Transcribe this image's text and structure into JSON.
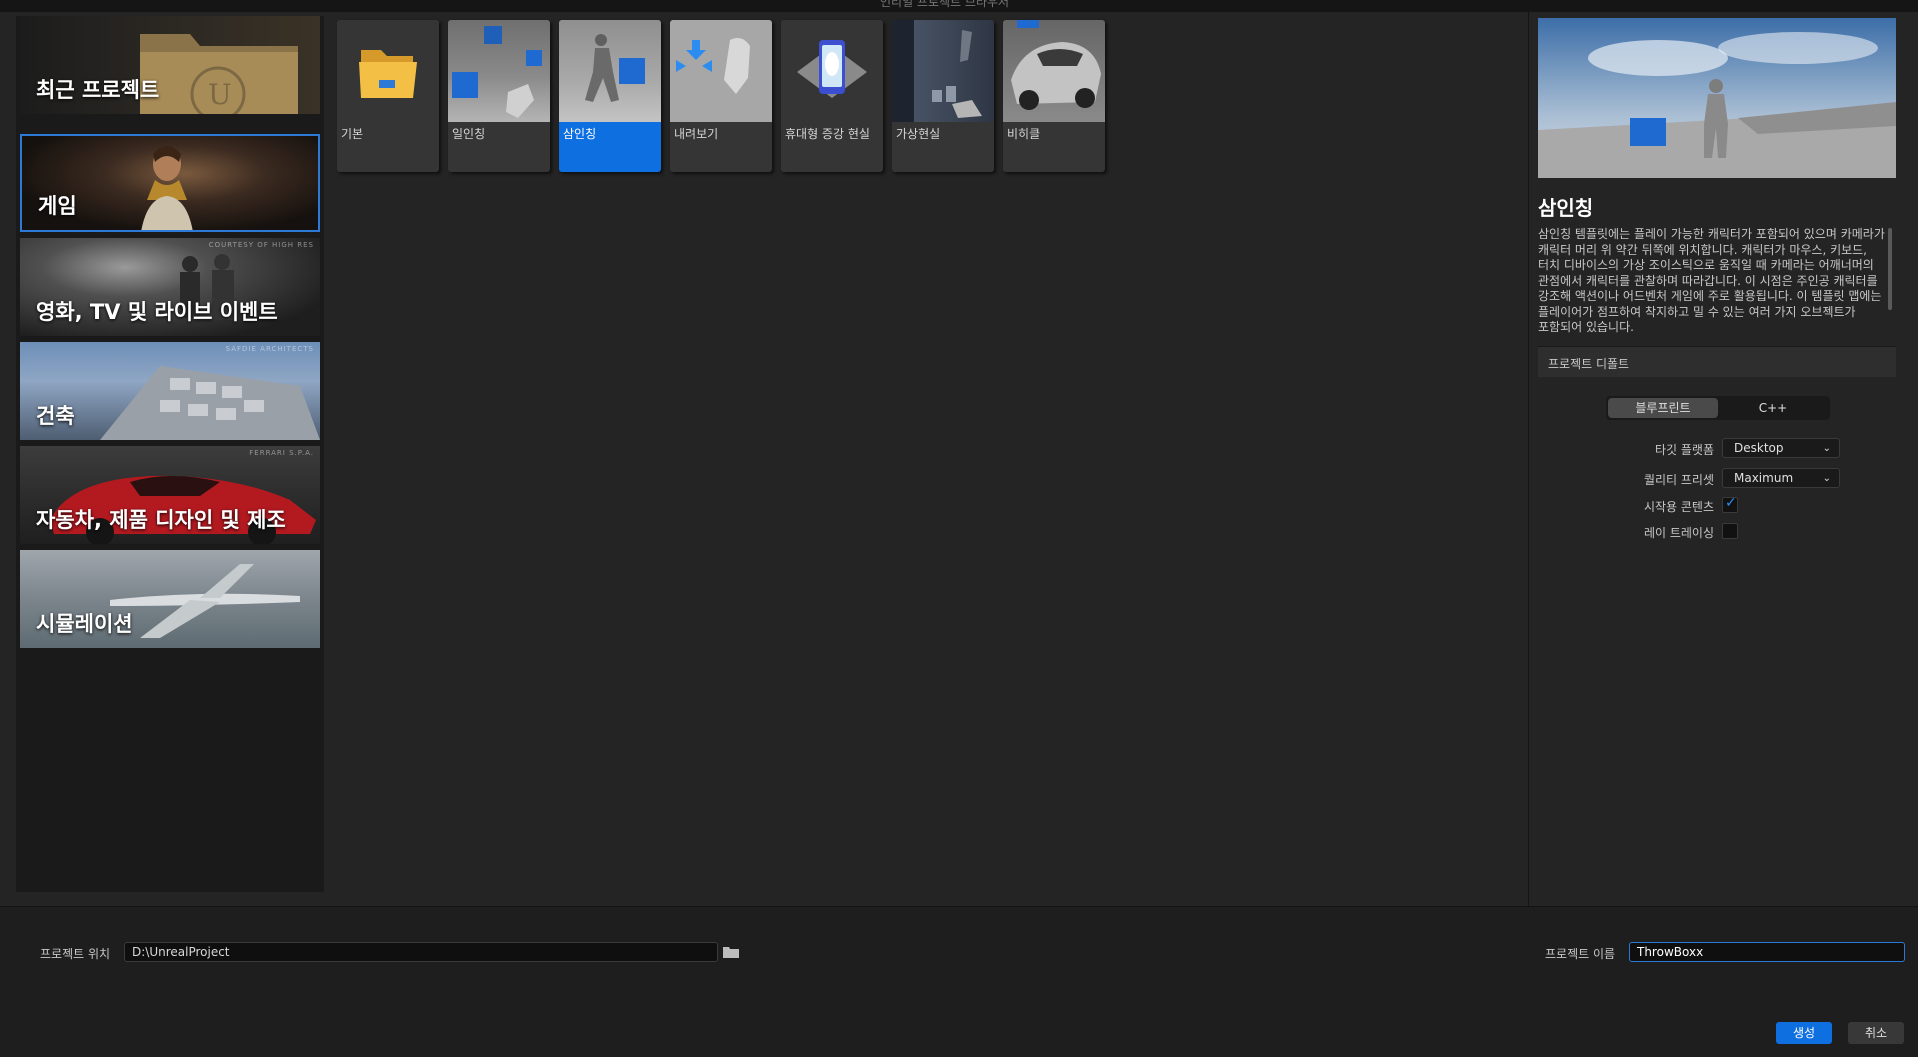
{
  "window": {
    "title": "언리얼 프로젝트 브라우저"
  },
  "categories": [
    {
      "id": "recent",
      "label": "최근 프로젝트",
      "credit": ""
    },
    {
      "id": "games",
      "label": "게임",
      "credit": ""
    },
    {
      "id": "film",
      "label": "영화, TV 및 라이브 이벤트",
      "credit": "COURTESY OF HIGH RES"
    },
    {
      "id": "architecture",
      "label": "건축",
      "credit": "SAFDIE ARCHITECTS"
    },
    {
      "id": "automotive",
      "label": "자동차, 제품 디자인 및 제조",
      "credit": "FERRARI S.P.A."
    },
    {
      "id": "simulation",
      "label": "시뮬레이션",
      "credit": ""
    }
  ],
  "selected_category": "게임",
  "templates": [
    {
      "label": "기본",
      "icon": "folder-icon"
    },
    {
      "label": "일인칭",
      "icon": "first-person-thumbnail"
    },
    {
      "label": "삼인칭",
      "icon": "third-person-thumbnail"
    },
    {
      "label": "내려보기",
      "icon": "top-down-thumbnail"
    },
    {
      "label": "휴대형 증강 현실",
      "icon": "handheld-ar-icon"
    },
    {
      "label": "가상현실",
      "icon": "vr-thumbnail"
    },
    {
      "label": "비히클",
      "icon": "vehicle-thumbnail"
    }
  ],
  "selected_template": "삼인칭",
  "details": {
    "title": "삼인칭",
    "description": "삼인칭 템플릿에는 플레이 가능한 캐릭터가 포함되어 있으며 카메라가 캐릭터 머리 위 약간 뒤쪽에 위치합니다. 캐릭터가 마우스, 키보드, 터치 디바이스의 가상 조이스틱으로 움직일 때 카메라는 어깨너머의 관점에서 캐릭터를 관찰하며 따라갑니다. 이 시점은 주인공 캐릭터를 강조해 액션이나 어드벤처 게임에 주로 활용됩니다. 이 템플릿 맵에는 플레이어가 점프하여 착지하고 밀 수 있는 여러 가지 오브젝트가 포함되어 있습니다.",
    "section_title": "프로젝트 디폴트",
    "language_options": [
      "블루프린트",
      "C++"
    ],
    "selected_language": "블루프린트",
    "target_platform_label": "타깃 플랫폼",
    "target_platform_value": "Desktop",
    "quality_preset_label": "퀄리티 프리셋",
    "quality_preset_value": "Maximum",
    "starter_content_label": "시작용 콘텐츠",
    "starter_content_checked": true,
    "raytracing_label": "레이 트레이싱",
    "raytracing_checked": false
  },
  "bottom": {
    "location_label": "프로젝트 위치",
    "location_value": "D:\\UnrealProject",
    "name_label": "프로젝트 이름",
    "name_value": "ThrowBoxx",
    "create_label": "생성",
    "cancel_label": "취소"
  },
  "colors": {
    "accent": "#0e6fe0",
    "background": "#242424",
    "panel": "#1a1a1a"
  }
}
